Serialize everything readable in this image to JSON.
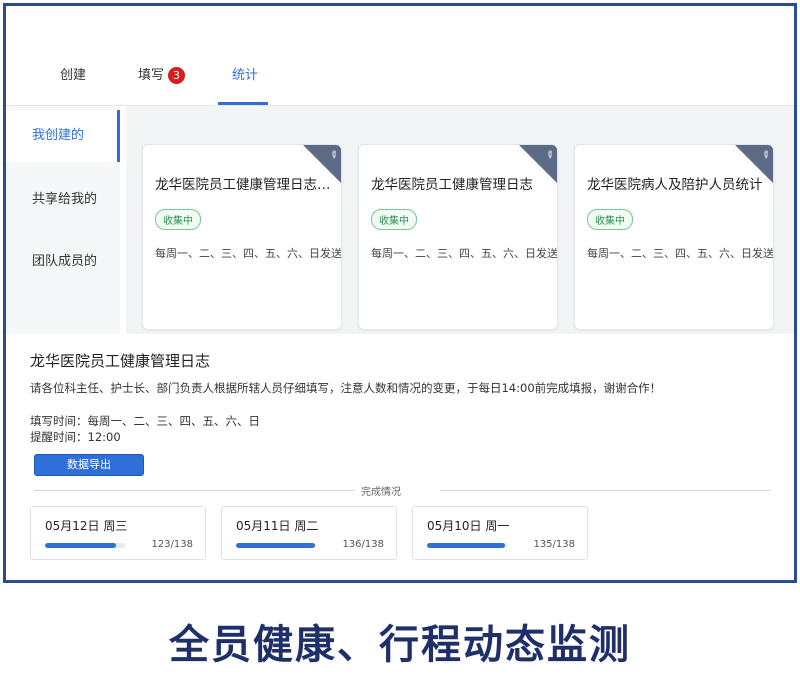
{
  "tabs": [
    {
      "label": "创建"
    },
    {
      "label": "填写",
      "badge": "3"
    },
    {
      "label": "统计"
    }
  ],
  "sidebar": {
    "items": [
      {
        "label": "我创建的"
      },
      {
        "label": "共享给我的"
      },
      {
        "label": "团队成员的"
      }
    ]
  },
  "cards": [
    {
      "title": "龙华医院员工健康管理日志-...",
      "tag": "收集中",
      "days": "每周一、二、三、四、五、六、日发送"
    },
    {
      "title": "龙华医院员工健康管理日志",
      "tag": "收集中",
      "days": "每周一、二、三、四、五、六、日发送"
    },
    {
      "title": "龙华医院病人及陪护人员统计",
      "tag": "收集中",
      "days": "每周一、二、三、四、五、六、日发送"
    }
  ],
  "detail": {
    "title": "龙华医院员工健康管理日志",
    "description": "请各位科主任、护士长、部门负责人根据所辖人员仔细填写，注意人数和情况的变更，于每日14:00前完成填报，谢谢合作！",
    "fill_time": "填写时间：每周一、二、三、四、五、六、日",
    "remind_time": "提醒时间：12:00",
    "export_label": "数据导出",
    "section_label": "完成情况"
  },
  "stats": [
    {
      "date": "05月12日 周三",
      "done": 123,
      "total": 138,
      "count": "123/138"
    },
    {
      "date": "05月11日 周二",
      "done": 136,
      "total": 138,
      "count": "136/138"
    },
    {
      "date": "05月10日 周一",
      "done": 135,
      "total": 138,
      "count": "135/138"
    }
  ],
  "caption": "全员健康、行程动态监测",
  "colors": {
    "accent": "#2f6fd8",
    "badge": "#d51e1e",
    "frame": "#2a4d8f",
    "caption": "#1f2f6a"
  }
}
